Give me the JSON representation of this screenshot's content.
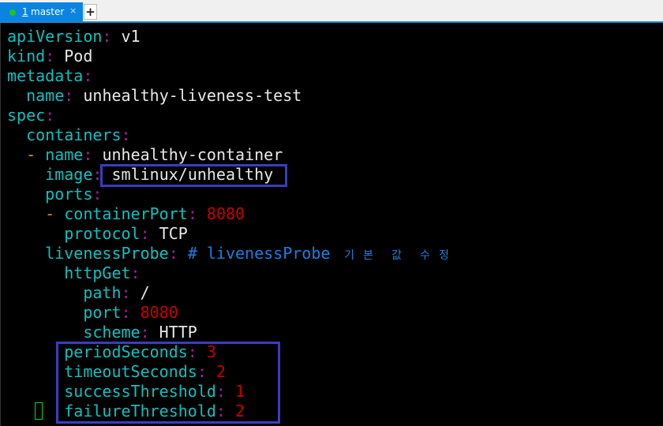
{
  "tab": {
    "number": "1",
    "label": "master",
    "close": "×",
    "status_color": "#1fc41f",
    "new_tab": "+"
  },
  "colors": {
    "key": "#10c0c0",
    "colon": "#a020a0",
    "number": "#c80000",
    "dash": "#d0a000",
    "comment": "#1a7fe0",
    "highlight_box": "#3c3cc0",
    "cursor": "#00e000"
  },
  "lines": [
    {
      "indent": 0,
      "key": "apiVersion",
      "value": "v1",
      "vtype": "str"
    },
    {
      "indent": 0,
      "key": "kind",
      "value": "Pod",
      "vtype": "str"
    },
    {
      "indent": 0,
      "key": "metadata"
    },
    {
      "indent": 2,
      "key": "name",
      "value": "unhealthy-liveness-test",
      "vtype": "str"
    },
    {
      "indent": 0,
      "key": "spec"
    },
    {
      "indent": 2,
      "key": "containers"
    },
    {
      "indent": 2,
      "dash": true,
      "key": "name",
      "value": "unhealthy-container",
      "vtype": "str"
    },
    {
      "indent": 4,
      "key": "image",
      "value": "smlinux/unhealthy",
      "vtype": "str"
    },
    {
      "indent": 4,
      "key": "ports"
    },
    {
      "indent": 4,
      "dash": true,
      "key": "containerPort",
      "value": "8080",
      "vtype": "num"
    },
    {
      "indent": 6,
      "key": "protocol",
      "value": "TCP",
      "vtype": "str"
    },
    {
      "indent": 4,
      "key": "livenessProbe",
      "comment": "# livenessProbe",
      "comment_korean": [
        "기",
        "본",
        " ",
        "값",
        " ",
        "수",
        "정"
      ]
    },
    {
      "indent": 6,
      "key": "httpGet"
    },
    {
      "indent": 8,
      "key": "path",
      "value": "/",
      "vtype": "str"
    },
    {
      "indent": 8,
      "key": "port",
      "value": "8080",
      "vtype": "num"
    },
    {
      "indent": 8,
      "key": "scheme",
      "value": "HTTP",
      "vtype": "str"
    },
    {
      "indent": 6,
      "key": "periodSeconds",
      "value": "3",
      "vtype": "num"
    },
    {
      "indent": 6,
      "key": "timeoutSeconds",
      "value": "2",
      "vtype": "num"
    },
    {
      "indent": 6,
      "key": "successThreshold",
      "value": "1",
      "vtype": "num"
    },
    {
      "indent": 6,
      "key": "failureThreshold",
      "value": "2",
      "vtype": "num"
    }
  ]
}
